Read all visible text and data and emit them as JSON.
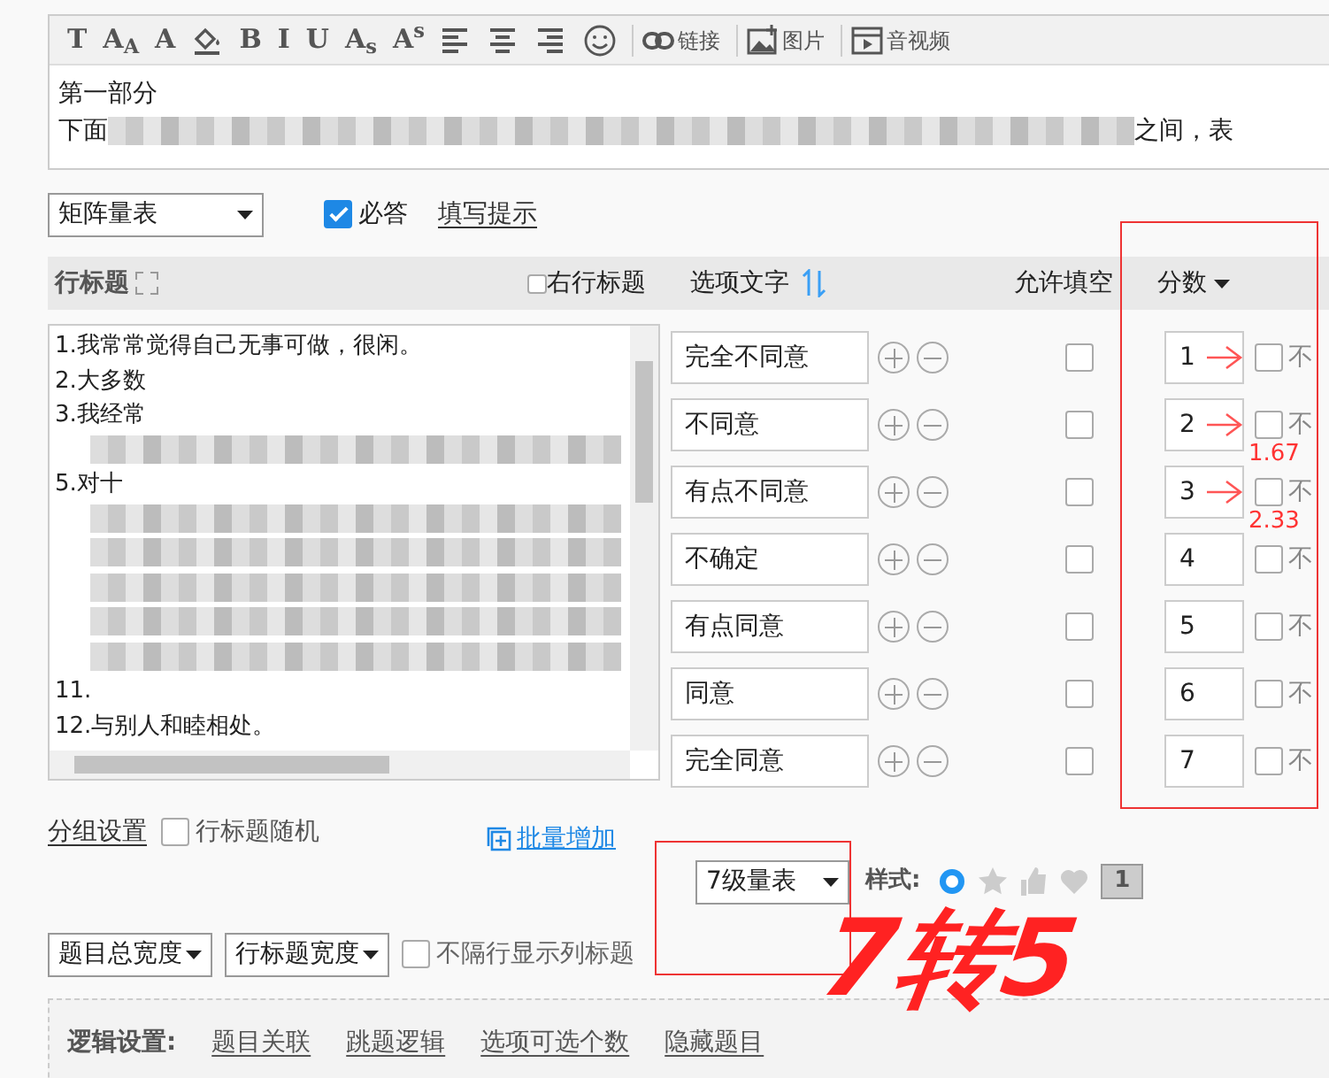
{
  "toolbar": [
    {
      "kind": "glyph",
      "text": "T"
    },
    {
      "kind": "glyph",
      "text": "A$_{A}$"
    },
    {
      "kind": "glyph",
      "text": "A"
    },
    {
      "kind": "fill-color"
    },
    {
      "kind": "glyph",
      "text": "B"
    },
    {
      "kind": "glyph",
      "text": "I"
    },
    {
      "kind": "glyph",
      "text": "U"
    },
    {
      "kind": "glyph",
      "text": "A$_{s}$"
    },
    {
      "kind": "glyph",
      "text": "A$^{s}$"
    },
    {
      "kind": "align-left"
    },
    {
      "kind": "align-center"
    },
    {
      "kind": "align-right"
    },
    {
      "kind": "emoji"
    },
    {
      "kind": "link",
      "label": "链接"
    },
    {
      "kind": "image",
      "label": "图片"
    },
    {
      "kind": "video",
      "label": "音视频"
    }
  ],
  "description": {
    "line_1": "第一部分",
    "line_2_start": "下面",
    "line_2_end": "之间，表"
  },
  "question_type": "矩阵量表",
  "required": {
    "label": "必答",
    "checked": true
  },
  "hint_link": "填写提示",
  "header": {
    "row_title": "行标题",
    "right_row_title": {
      "label": "右行标题",
      "checked": false
    },
    "option_text": "选项文字",
    "allow_fill": "允许填空",
    "score": "分数"
  },
  "row_titles": [
    {
      "kind": "text",
      "text": "1.我常常觉得自己无事可做，很闲。"
    },
    {
      "kind": "text",
      "text": "2.大多数"
    },
    {
      "kind": "text",
      "text": "3.我经常"
    },
    {
      "kind": "mosaic"
    },
    {
      "kind": "text",
      "text": "5.对十"
    },
    {
      "kind": "mosaic"
    },
    {
      "kind": "mosaic"
    },
    {
      "kind": "mosaic"
    },
    {
      "kind": "mosaic"
    },
    {
      "kind": "mosaic"
    },
    {
      "kind": "text",
      "text": "11."
    },
    {
      "kind": "text",
      "text": "12.与别人和睦相处。"
    }
  ],
  "options": [
    {
      "text": "完全不同意",
      "allow_fill": false,
      "score": "1",
      "no_score": {
        "label": "不",
        "checked": false
      },
      "arrow": true
    },
    {
      "text": "不同意",
      "allow_fill": false,
      "score": "2",
      "no_score": {
        "label": "不",
        "checked": false
      },
      "arrow": true,
      "note": "1.67"
    },
    {
      "text": "有点不同意",
      "allow_fill": false,
      "score": "3",
      "no_score": {
        "label": "不",
        "checked": false
      },
      "arrow": true,
      "note": "2.33"
    },
    {
      "text": "不确定",
      "allow_fill": false,
      "score": "4",
      "no_score": {
        "label": "不",
        "checked": false
      },
      "arrow": false
    },
    {
      "text": "有点同意",
      "allow_fill": false,
      "score": "5",
      "no_score": {
        "label": "不",
        "checked": false
      },
      "arrow": false
    },
    {
      "text": "同意",
      "allow_fill": false,
      "score": "6",
      "no_score": {
        "label": "不",
        "checked": false
      },
      "arrow": false
    },
    {
      "text": "完全同意",
      "allow_fill": false,
      "score": "7",
      "no_score": {
        "label": "不",
        "checked": false
      },
      "arrow": false
    }
  ],
  "group_settings": "分组设置",
  "random_rows": {
    "label": "行标题随机",
    "checked": false
  },
  "batch_add": "批量增加",
  "scale": "7级量表",
  "style": {
    "label": "样式:",
    "items": [
      {
        "kind": "radio",
        "selected": true
      },
      {
        "kind": "star",
        "selected": false
      },
      {
        "kind": "thumb",
        "selected": false
      },
      {
        "kind": "heart",
        "selected": false
      },
      {
        "kind": "number",
        "text": "1",
        "selected": false
      }
    ]
  },
  "width_selects": [
    "题目总宽度",
    "行标题宽度"
  ],
  "no_alt_header": {
    "label": "不隔行显示列标题",
    "checked": false
  },
  "logic": {
    "label": "逻辑设置:",
    "links": [
      "题目关联",
      "跳题逻辑",
      "选项可选个数",
      "隐藏题目"
    ]
  },
  "handwritten_note": "7转5"
}
